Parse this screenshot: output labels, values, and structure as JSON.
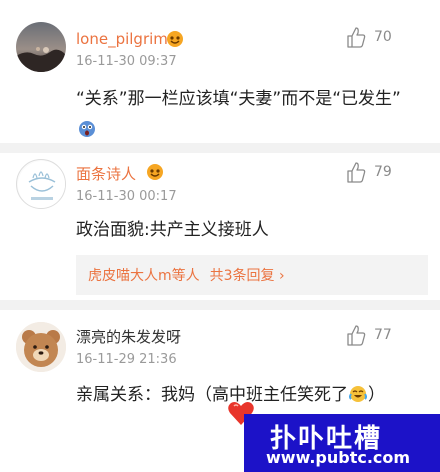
{
  "comments": [
    {
      "username": "lone_pilgrim",
      "timestamp": "16-11-30 09:37",
      "likes": "70",
      "text": "“关系”那一栏应该填“夫妻”而不是“已发生”"
    },
    {
      "username": "面条诗人",
      "timestamp": "16-11-30 00:17",
      "likes": "79",
      "text": "政治面貌:共产主义接班人",
      "replies": {
        "text": "虎皮喵大人m等人",
        "count": "共3条回复 ›"
      }
    },
    {
      "username": "漂亮的朱发发呀",
      "timestamp": "16-11-29 21:36",
      "likes": "77",
      "text": "亲属关系：我妈（高中班主任笑死了"
    }
  ],
  "watermark": {
    "title": "扑卟吐槽",
    "url": "www.pubtc.com"
  },
  "colors": {
    "username_orange": "#eb7340",
    "watermark_bg": "#1c12c8",
    "separator": "#f2f2f2"
  }
}
